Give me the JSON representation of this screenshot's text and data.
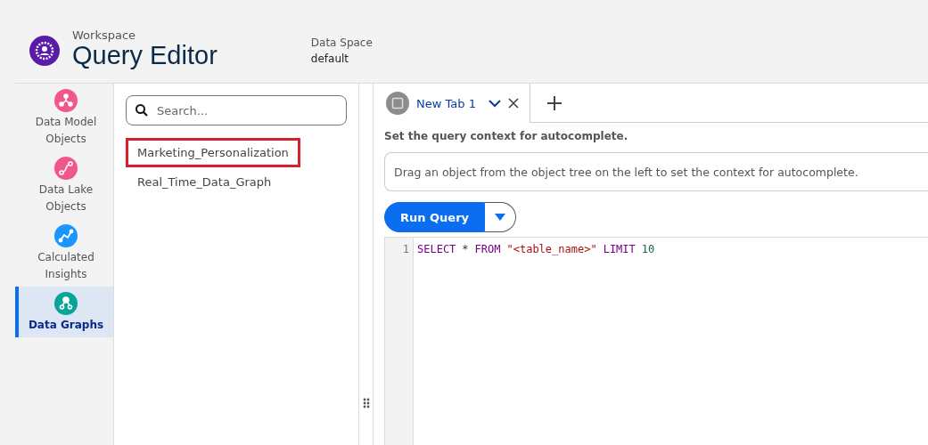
{
  "header": {
    "eyebrow": "Workspace",
    "title": "Query Editor",
    "data_space": {
      "label": "Data Space",
      "value": "default"
    }
  },
  "nav": [
    {
      "label": "Data Model Objects",
      "kind": "model",
      "color": "#f0588a",
      "selected": false
    },
    {
      "label": "Data Lake Objects",
      "kind": "lake",
      "color": "#f0588a",
      "selected": false
    },
    {
      "label": "Calculated Insights",
      "kind": "insight",
      "color": "#1b96ff",
      "selected": false
    },
    {
      "label": "Data Graphs",
      "kind": "graph",
      "color": "#06a59a",
      "selected": true
    }
  ],
  "tree": {
    "search_placeholder": "Search...",
    "items": [
      {
        "label": "Marketing_Personalization",
        "selected": true
      },
      {
        "label": "Real_Time_Data_Graph",
        "selected": false
      }
    ]
  },
  "tabs": [
    {
      "label": "New Tab 1",
      "selected": true
    }
  ],
  "context": {
    "label": "Set the query context for autocomplete.",
    "placeholder": "Drag an object from the object tree on the left to set the context for autocomplete."
  },
  "run_button": "Run Query",
  "code": [
    {
      "number": "1",
      "tokens": [
        {
          "text": "SELECT",
          "kind": "keyword"
        },
        {
          "text": "*",
          "kind": "operator"
        },
        {
          "text": "FROM",
          "kind": "keyword"
        },
        {
          "text": "\"<table_name>\"",
          "kind": "string"
        },
        {
          "text": "LIMIT",
          "kind": "keyword"
        },
        {
          "text": "10",
          "kind": "number"
        }
      ]
    }
  ]
}
